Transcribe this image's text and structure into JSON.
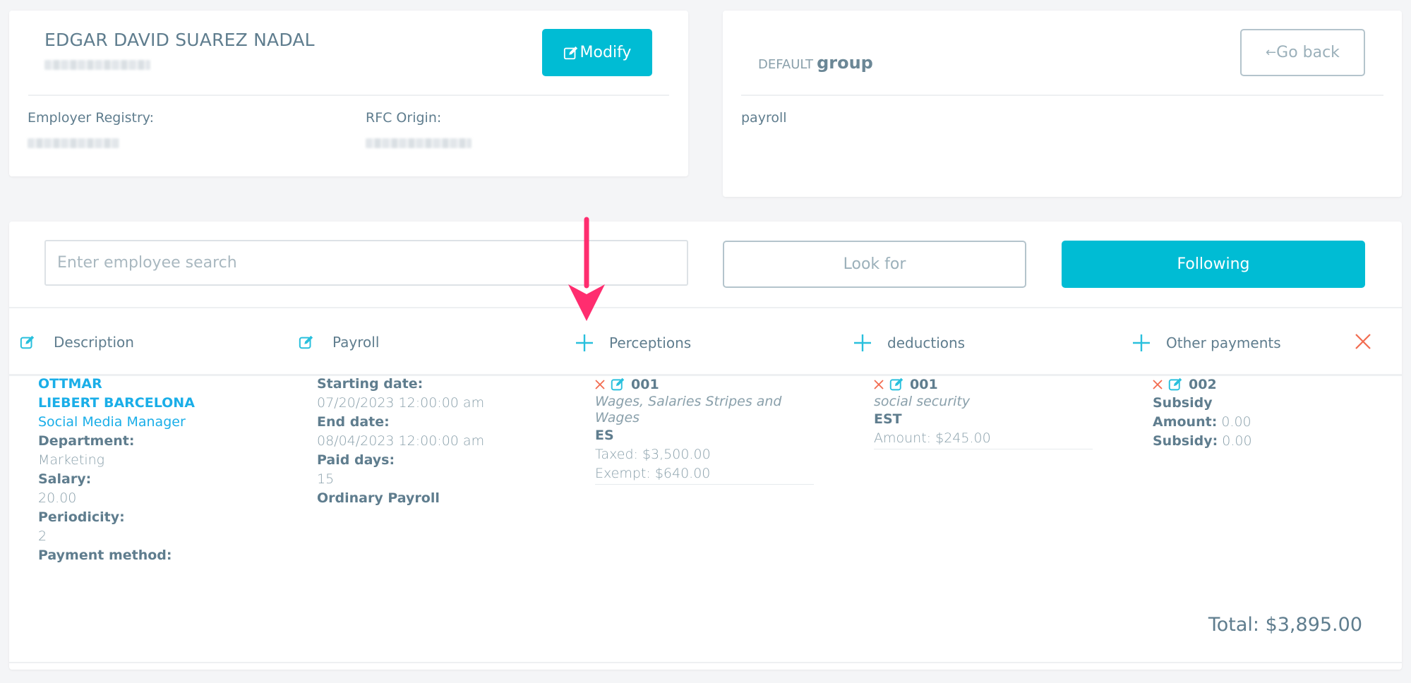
{
  "employee_card": {
    "name": "EDGAR DAVID SUAREZ NADAL",
    "modify_label": "Modify",
    "employer_registry_label": "Employer Registry:",
    "rfc_origin_label": "RFC Origin:"
  },
  "group_card": {
    "group_prefix": "DEFAULT",
    "group_word": "group",
    "go_back_label": "Go back",
    "go_back_arrow": "←",
    "payroll_label": "payroll"
  },
  "search": {
    "placeholder": "Enter employee search",
    "value": "",
    "look_for_label": "Look for",
    "following_label": "Following"
  },
  "columns": [
    {
      "label": "Description",
      "icon": "edit-icon"
    },
    {
      "label": "Payroll",
      "icon": "edit-icon"
    },
    {
      "label": "Perceptions",
      "icon": "plus-icon"
    },
    {
      "label": "deductions",
      "icon": "plus-icon"
    },
    {
      "label": "Other payments",
      "icon": "plus-icon"
    }
  ],
  "row": {
    "description": {
      "first_name": "OTTMAR",
      "last_name": "LIEBERT BARCELONA",
      "position": "Social Media Manager",
      "department_label": "Department:",
      "department": "Marketing",
      "salary_label": "Salary:",
      "salary": "20.00",
      "periodicity_label": "Periodicity:",
      "periodicity": "2",
      "payment_method_label": "Payment method:"
    },
    "payroll": {
      "start_label": "Starting date:",
      "start": "07/20/2023 12:00:00 am",
      "end_label": "End date:",
      "end": "08/04/2023 12:00:00 am",
      "paid_days_label": "Paid days:",
      "paid_days": "15",
      "type": "Ordinary Payroll"
    },
    "perception": {
      "code": "001",
      "description": "Wages, Salaries Stripes and Wages",
      "type": "ES",
      "taxed": "Taxed: $3,500.00",
      "exempt": "Exempt: $640.00"
    },
    "deduction": {
      "code": "001",
      "description": "social security",
      "type": "EST",
      "amount": "Amount: $245.00"
    },
    "other_payment": {
      "code": "002",
      "description": "Subsidy",
      "amount_label": "Amount:",
      "amount": "0.00",
      "subsidy_label": "Subsidy:",
      "subsidy": "0.00"
    },
    "total": "Total: $3,895.00"
  },
  "colors": {
    "primary": "#00bcd4",
    "link": "#1aaee8",
    "danger": "#f26b4f",
    "text": "#5f7d8e",
    "annotation_arrow": "#ff2d6f"
  }
}
